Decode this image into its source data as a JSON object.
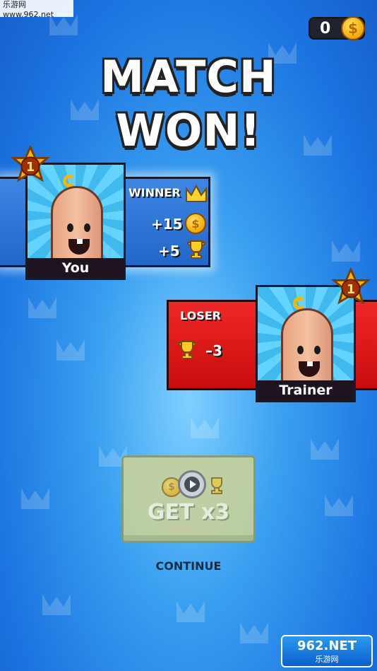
{
  "watermark": {
    "text": "乐游网 www.962.net"
  },
  "currency": {
    "coins": "0",
    "coin_symbol": "$"
  },
  "title": {
    "line1": "MATCH",
    "line2": "WON!"
  },
  "winner": {
    "rank": "1",
    "name": "You",
    "status": "WINNER",
    "coins_gain": "+15",
    "trophies_gain": "+5"
  },
  "loser": {
    "rank": "1",
    "name": "Trainer",
    "status": "LOSER",
    "trophies_change": "–3"
  },
  "reward_button": {
    "label": "GET x3",
    "sublabel": "WATCH AD"
  },
  "continue_label": "CONTINUE",
  "logo": {
    "main": "962.NET",
    "sub": "乐游网"
  },
  "colors": {
    "background": "#2a88e8",
    "winner_panel": "#2f74d6",
    "loser_panel": "#e01a1a",
    "gold": "#f5a800",
    "button": "#c8d29a"
  }
}
